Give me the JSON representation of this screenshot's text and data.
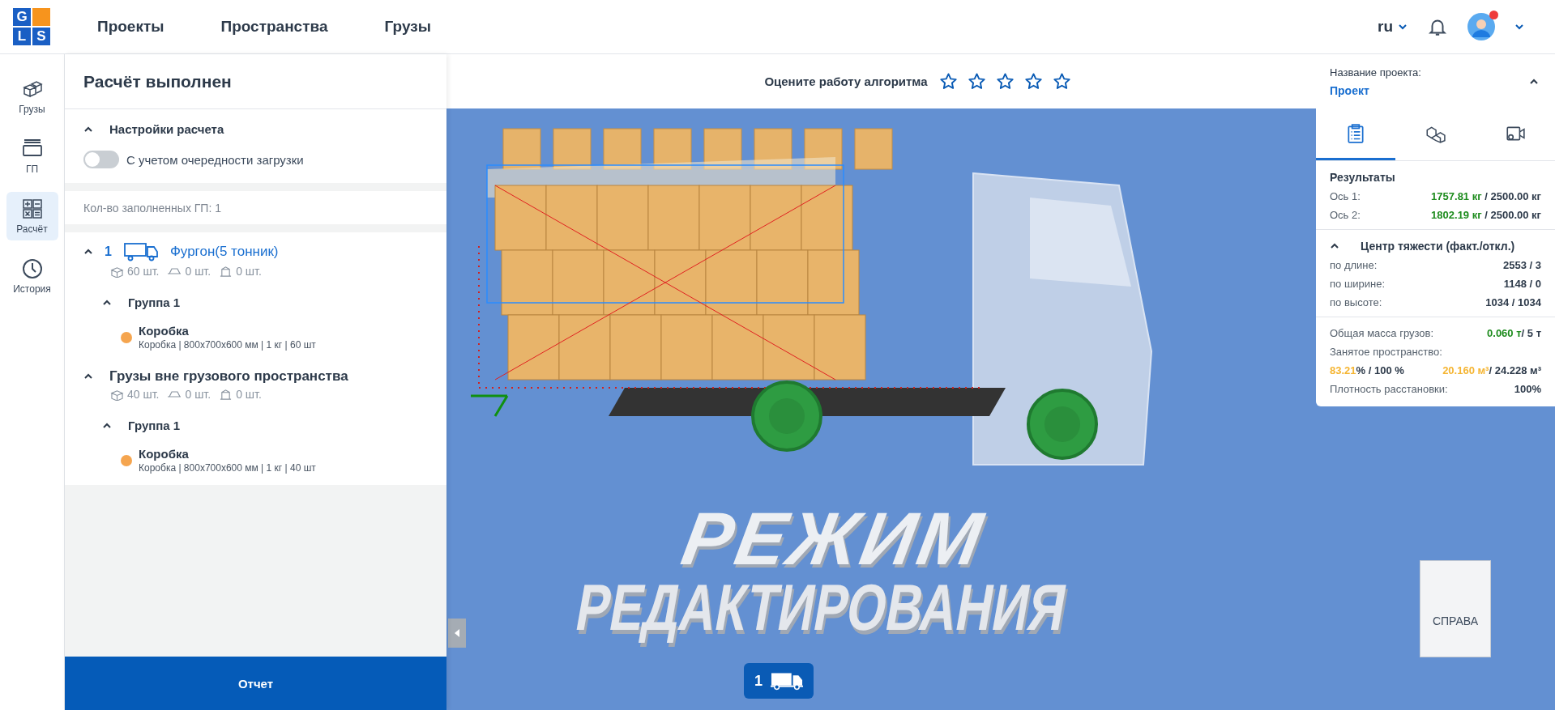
{
  "header": {
    "logo_letters": [
      "G",
      "L",
      "S"
    ],
    "nav": [
      {
        "label": "Проекты"
      },
      {
        "label": "Пространства"
      },
      {
        "label": "Грузы"
      }
    ],
    "language": "ru",
    "has_notification": true
  },
  "rail": [
    {
      "kind": "cargo",
      "label": "Грузы",
      "selected": false
    },
    {
      "kind": "space",
      "label": "ГП",
      "selected": false
    },
    {
      "kind": "calc",
      "label": "Расчёт",
      "selected": true
    },
    {
      "kind": "history",
      "label": "История",
      "selected": false
    }
  ],
  "panel": {
    "title": "Расчёт выполнен",
    "settings": {
      "title": "Настройки расчета",
      "expanded": true,
      "toggle": {
        "label": "С учетом очередности загрузки",
        "on": false
      }
    },
    "filled_count": "Кол-во заполненных ГП: 1",
    "sections": [
      {
        "kind": "vehicle",
        "number": "1",
        "title": "Фургон(5 тонник)",
        "expanded": true,
        "counts": [
          "60 шт.",
          "0 шт.",
          "0 шт."
        ],
        "groups": [
          {
            "name": "Группа 1",
            "expanded": true,
            "items": [
              {
                "name": "Коробка",
                "details": "Коробка | 800x700x600 мм | 1 кг | 60 шт",
                "color": "#f5a54f"
              }
            ]
          }
        ]
      },
      {
        "kind": "outside",
        "title": "Грузы вне грузового пространства",
        "expanded": true,
        "counts": [
          "40 шт.",
          "0 шт.",
          "0 шт."
        ],
        "groups": [
          {
            "name": "Группа 1",
            "expanded": true,
            "items": [
              {
                "name": "Коробка",
                "details": "Коробка | 800x700x600 мм | 1 кг | 40 шт",
                "color": "#f5a54f"
              }
            ]
          }
        ]
      }
    ],
    "report_button": "Отчет"
  },
  "rating": {
    "label": "Оцените работу алгоритма",
    "stars": 0
  },
  "project": {
    "label": "Название проекта:",
    "name": "Проект",
    "expanded": true
  },
  "result_tabs": [
    {
      "kind": "list",
      "selected": true
    },
    {
      "kind": "boxes",
      "selected": false
    },
    {
      "kind": "camera",
      "selected": false
    }
  ],
  "results": {
    "title": "Результаты",
    "axes": [
      {
        "label": "Ось 1:",
        "value": "1757.81 кг",
        "limit": " / 2500.00 кг"
      },
      {
        "label": "Ось 2:",
        "value": "1802.19 кг",
        "limit": " / 2500.00 кг"
      }
    ],
    "center": {
      "title": "Центр тяжести (факт./откл.)",
      "expanded": true,
      "rows": [
        {
          "label": "по длине:",
          "value": "2553 / 3"
        },
        {
          "label": "по ширине:",
          "value": "1148 / 0"
        },
        {
          "label": "по высоте:",
          "value": "1034 / 1034"
        }
      ]
    },
    "mass": {
      "label": "Общая масса грузов:",
      "value": "0.060 т",
      "limit": "/ 5 т"
    },
    "space": {
      "label": "Занятое пространство:",
      "percent": "83.21",
      "percent_rest": "% / 100 %",
      "volume": "20.160 м³",
      "volume_rest": "/ 24.228 м³"
    },
    "density": {
      "label": "Плотность расстановки:",
      "value": "100%"
    }
  },
  "scene": {
    "mode_text": [
      "РЕЖИМ",
      "РЕДАКТИРОВАНИЯ"
    ],
    "view_cube": "СПРАВА",
    "vehicle_tabs": [
      {
        "number": "1",
        "selected": true
      }
    ]
  }
}
